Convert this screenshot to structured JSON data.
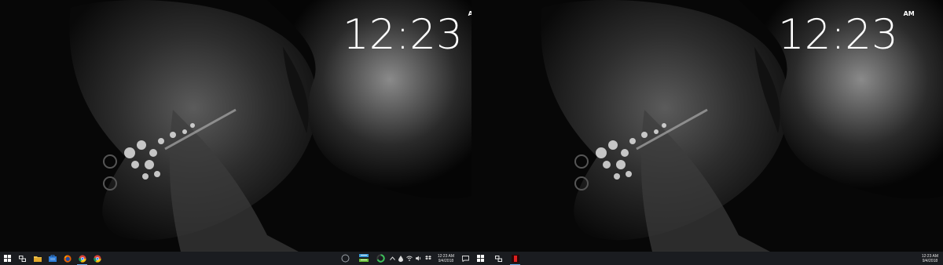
{
  "screen": {
    "accent": "#6aa8e6",
    "taskbar_bg": "#1a1c20"
  },
  "left_monitor": {
    "clock": {
      "time": "12:23",
      "ampm": "AM"
    },
    "taskbar": {
      "start_icon": "windows-icon",
      "task_view_icon": "task-view-icon",
      "pinned": [
        {
          "name": "file-explorer-icon"
        },
        {
          "name": "store-icon"
        },
        {
          "name": "firefox-icon"
        },
        {
          "name": "chrome-icon",
          "active": true
        },
        {
          "name": "chrome-alt-icon"
        }
      ],
      "tray": {
        "network_meter": "network-meter-icon",
        "cortana_icon": "cortana-icon",
        "battery_ring_icon": "battery-ring-icon",
        "date": "9/4/2018",
        "time": "12:23 AM"
      }
    }
  },
  "right_monitor": {
    "clock": {
      "time": "12:23",
      "ampm": "AM"
    },
    "taskbar": {
      "start_icon": "windows-icon",
      "task_view_icon": "task-view-icon",
      "pinned": [
        {
          "name": "red-app-icon",
          "active": true
        }
      ],
      "tray": {
        "date": "9/4/2018",
        "time": "12:23 AM"
      }
    }
  }
}
